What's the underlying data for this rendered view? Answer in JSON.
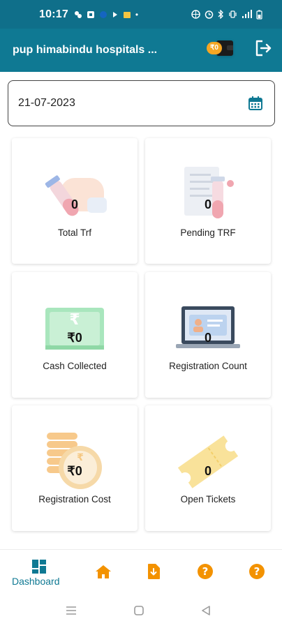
{
  "status_bar": {
    "time": "10:17",
    "dot": "•"
  },
  "app_bar": {
    "title": "pup himabindu hospitals ...",
    "wallet_value": "₹0"
  },
  "date_field": {
    "value": "21-07-2023"
  },
  "cards": [
    {
      "value": "0",
      "label": "Total Trf",
      "icon": "test-tube-hand-icon"
    },
    {
      "value": "0",
      "label": "Pending TRF",
      "icon": "report-tube-icon"
    },
    {
      "value": "₹0",
      "label": "Cash Collected",
      "icon": "cash-note-icon"
    },
    {
      "value": "0",
      "label": "Registration Count",
      "icon": "laptop-id-icon"
    },
    {
      "value": "₹0",
      "label": "Registration Cost",
      "icon": "coin-stack-icon"
    },
    {
      "value": "0",
      "label": "Open Tickets",
      "icon": "ticket-icon"
    }
  ],
  "bottom_nav": {
    "dashboard_label": "Dashboard"
  },
  "colors": {
    "primary": "#0f7993",
    "status_bar": "#0f6f8a",
    "accent": "#f39200",
    "background": "#ffffff"
  }
}
